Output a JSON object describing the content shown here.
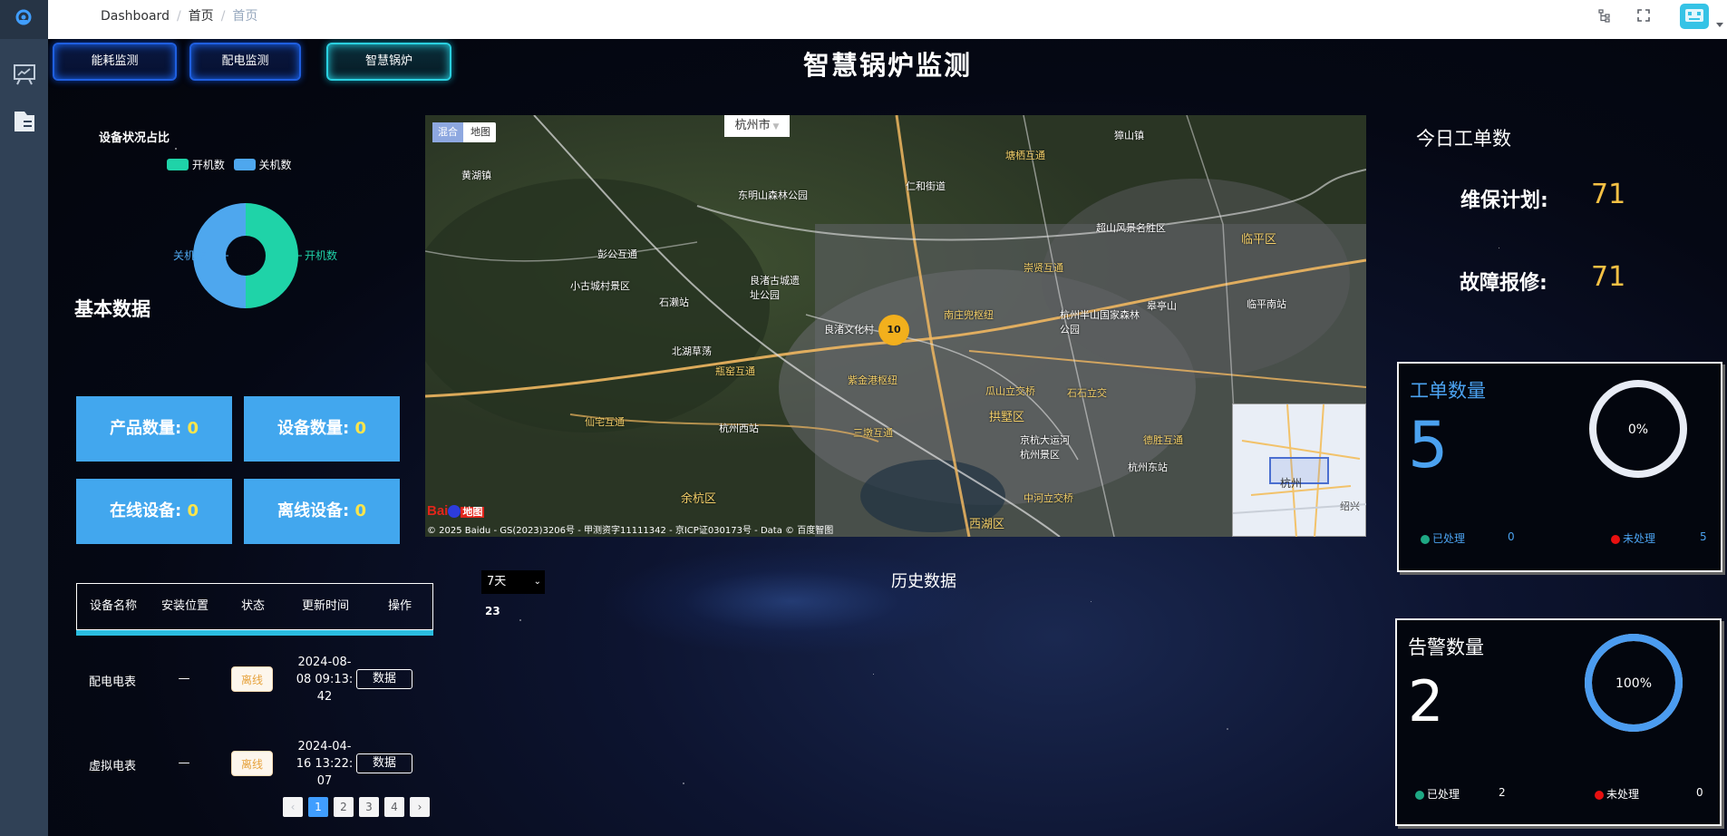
{
  "header": {
    "tooltip": "首页",
    "breadcrumb": [
      "Dashboard",
      "首页",
      "首页"
    ],
    "separator": "/"
  },
  "nav": {
    "tabs": [
      {
        "label": "能耗监测",
        "active": false
      },
      {
        "label": "配电监测",
        "active": false
      },
      {
        "label": "智慧锅炉",
        "active": true
      }
    ]
  },
  "page_title": "智慧锅炉监测",
  "device_status": {
    "title": "设备状况占比",
    "legend": [
      {
        "label": "开机数",
        "color": "#1fd3a8"
      },
      {
        "label": "关机数",
        "color": "#4ea7ee"
      }
    ],
    "on_label": "开机数",
    "off_label": "关机数"
  },
  "chart_data": {
    "type": "pie",
    "title": "设备状况占比",
    "categories": [
      "开机数",
      "关机数"
    ],
    "values": [
      50,
      50
    ],
    "colors": [
      "#1fd3a8",
      "#4ea7ee"
    ],
    "legend_position": "top"
  },
  "basic_data": {
    "title": "基本数据",
    "cards": [
      {
        "label": "产品数量: ",
        "value": "0"
      },
      {
        "label": "设备数量: ",
        "value": "0"
      },
      {
        "label": "在线设备: ",
        "value": "0"
      },
      {
        "label": "离线设备: ",
        "value": "0"
      }
    ]
  },
  "device_table": {
    "columns": [
      "设备名称",
      "安装位置",
      "状态",
      "更新时间",
      "操作"
    ],
    "rows": [
      {
        "name": "配电电表",
        "location": "—",
        "status": "离线",
        "time": [
          "2024-08-",
          "08 09:13:",
          "42"
        ],
        "action": "数据"
      },
      {
        "name": "虚拟电表",
        "location": "—",
        "status": "离线",
        "time": [
          "2024-04-",
          "16 13:22:",
          "07"
        ],
        "action": "数据"
      }
    ]
  },
  "pagination": {
    "pages": [
      "1",
      "2",
      "3",
      "4"
    ],
    "current": "1",
    "prev": "‹",
    "next": "›"
  },
  "map": {
    "mode_hybrid": "混合",
    "mode_map": "地图",
    "city": "杭州市",
    "cluster_count": "10",
    "copyright": "© 2025 Baidu - GS(2023)3206号 - 甲测资字11111342 - 京ICP证030173号 - Data © 百度智图",
    "logo_text": "Bai",
    "logo_suffix": "地图",
    "inset_label": "杭州",
    "inset_label2": "绍兴",
    "labels": [
      "东明山森林公园",
      "彭公互通",
      "小古城村景区",
      "石濑站",
      "良渚古城遗址公园",
      "良渚文化村",
      "北湖草荡",
      "瓶窑互通",
      "仙宅互通",
      "杭州西站",
      "三墩互通",
      "紫金港枢纽",
      "瓜山立交桥",
      "拱墅区",
      "石石立交",
      "杭州东站",
      "西湖区",
      "中河立交桥",
      "临平区",
      "临平南站",
      "皋亭山",
      "塘栖互通",
      "崇贤互通",
      "南庄兜枢纽",
      "超山风景名胜区",
      "杭州半山国家森林公园",
      "京杭大运河杭州景区",
      "德胜互通",
      "余杭区",
      "黄湖镇",
      "仁和街道",
      "獐山镇"
    ]
  },
  "history": {
    "range_select": "7天",
    "title": "历史数据",
    "value": "23"
  },
  "today_orders": {
    "title": "今日工单数",
    "maintenance_label": "维保计划:",
    "maintenance_value": "71",
    "repair_label": "故障报修:",
    "repair_value": "71"
  },
  "work_orders": {
    "title": "工单数量",
    "count": "5",
    "percent": "0%",
    "percent_value": 0,
    "done_label": "已处理",
    "done_value": "0",
    "undone_label": "未处理",
    "undone_value": "5",
    "done_color": "#1ea884",
    "undone_color": "#e81010",
    "ring_color": "#e8ecf5"
  },
  "alarms": {
    "title": "告警数量",
    "count": "2",
    "percent": "100%",
    "percent_value": 100,
    "done_label": "已处理",
    "done_value": "2",
    "undone_label": "未处理",
    "undone_value": "0",
    "ring_color": "#4b9cf0"
  }
}
